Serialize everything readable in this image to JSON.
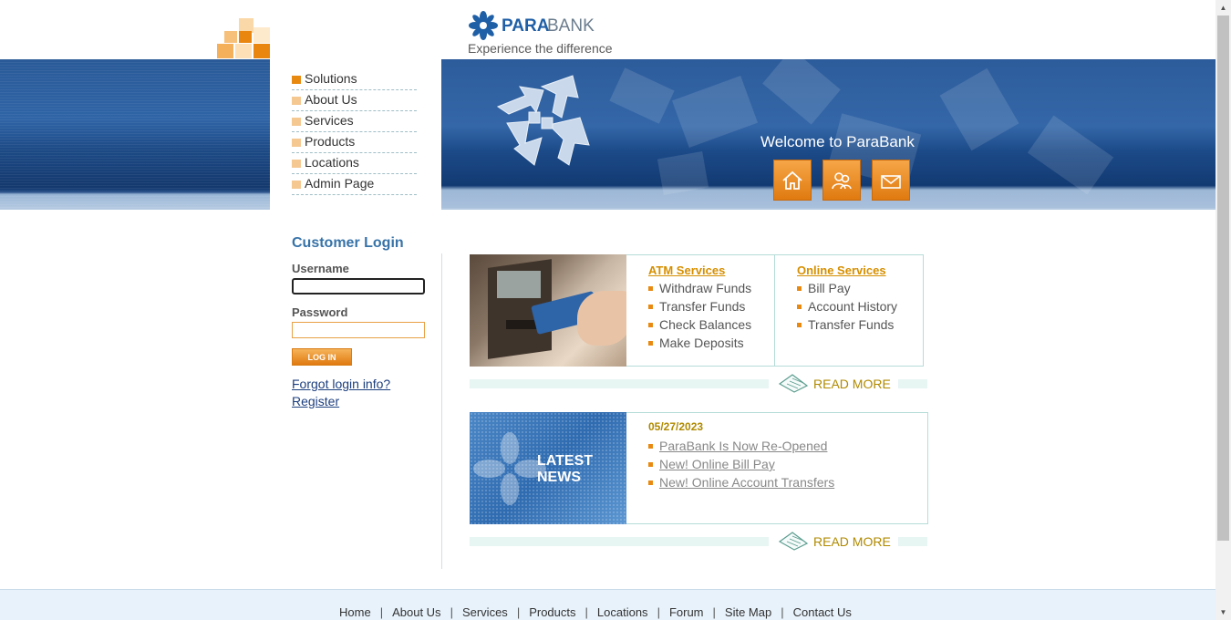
{
  "brand": {
    "name_para": "PARA",
    "name_bank": "BANK",
    "tagline": "Experience the difference",
    "colors": {
      "blue": "#1f5fa6",
      "orange": "#e88a12"
    }
  },
  "menu": {
    "items": [
      {
        "label": "Solutions"
      },
      {
        "label": "About Us"
      },
      {
        "label": "Services"
      },
      {
        "label": "Products"
      },
      {
        "label": "Locations"
      },
      {
        "label": "Admin Page"
      }
    ]
  },
  "banner": {
    "welcome": "Welcome to ParaBank",
    "icons": [
      "home-icon",
      "about-contact-icon",
      "mail-icon"
    ]
  },
  "login": {
    "title": "Customer Login",
    "username_label": "Username",
    "username_value": "",
    "password_label": "Password",
    "password_value": "",
    "button_label": "LOG IN",
    "forgot_label": "Forgot login info?",
    "register_label": "Register"
  },
  "services": {
    "atm": {
      "heading": "ATM Services",
      "items": [
        "Withdraw Funds",
        "Transfer Funds",
        "Check Balances",
        "Make Deposits"
      ]
    },
    "online": {
      "heading": "Online Services",
      "items": [
        "Bill Pay",
        "Account History",
        "Transfer Funds"
      ]
    },
    "read_more": "READ MORE"
  },
  "news": {
    "image_text_line1": "LATEST",
    "image_text_line2": "NEWS",
    "date": "05/27/2023",
    "items": [
      "ParaBank Is Now Re-Opened",
      "New! Online Bill Pay",
      "New! Online Account Transfers"
    ],
    "read_more": "READ MORE"
  },
  "footer": {
    "links": [
      "Home",
      "About Us",
      "Services",
      "Products",
      "Locations",
      "Forum",
      "Site Map",
      "Contact Us"
    ],
    "separator": "|"
  }
}
